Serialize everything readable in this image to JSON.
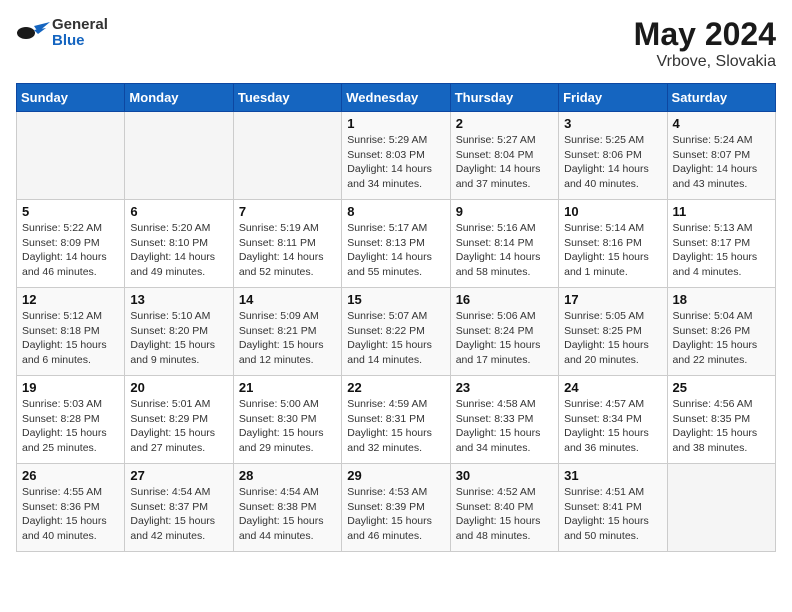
{
  "header": {
    "logo_general": "General",
    "logo_blue": "Blue",
    "month": "May 2024",
    "location": "Vrbove, Slovakia"
  },
  "weekdays": [
    "Sunday",
    "Monday",
    "Tuesday",
    "Wednesday",
    "Thursday",
    "Friday",
    "Saturday"
  ],
  "weeks": [
    [
      {
        "day": "",
        "info": ""
      },
      {
        "day": "",
        "info": ""
      },
      {
        "day": "",
        "info": ""
      },
      {
        "day": "1",
        "info": "Sunrise: 5:29 AM\nSunset: 8:03 PM\nDaylight: 14 hours\nand 34 minutes."
      },
      {
        "day": "2",
        "info": "Sunrise: 5:27 AM\nSunset: 8:04 PM\nDaylight: 14 hours\nand 37 minutes."
      },
      {
        "day": "3",
        "info": "Sunrise: 5:25 AM\nSunset: 8:06 PM\nDaylight: 14 hours\nand 40 minutes."
      },
      {
        "day": "4",
        "info": "Sunrise: 5:24 AM\nSunset: 8:07 PM\nDaylight: 14 hours\nand 43 minutes."
      }
    ],
    [
      {
        "day": "5",
        "info": "Sunrise: 5:22 AM\nSunset: 8:09 PM\nDaylight: 14 hours\nand 46 minutes."
      },
      {
        "day": "6",
        "info": "Sunrise: 5:20 AM\nSunset: 8:10 PM\nDaylight: 14 hours\nand 49 minutes."
      },
      {
        "day": "7",
        "info": "Sunrise: 5:19 AM\nSunset: 8:11 PM\nDaylight: 14 hours\nand 52 minutes."
      },
      {
        "day": "8",
        "info": "Sunrise: 5:17 AM\nSunset: 8:13 PM\nDaylight: 14 hours\nand 55 minutes."
      },
      {
        "day": "9",
        "info": "Sunrise: 5:16 AM\nSunset: 8:14 PM\nDaylight: 14 hours\nand 58 minutes."
      },
      {
        "day": "10",
        "info": "Sunrise: 5:14 AM\nSunset: 8:16 PM\nDaylight: 15 hours\nand 1 minute."
      },
      {
        "day": "11",
        "info": "Sunrise: 5:13 AM\nSunset: 8:17 PM\nDaylight: 15 hours\nand 4 minutes."
      }
    ],
    [
      {
        "day": "12",
        "info": "Sunrise: 5:12 AM\nSunset: 8:18 PM\nDaylight: 15 hours\nand 6 minutes."
      },
      {
        "day": "13",
        "info": "Sunrise: 5:10 AM\nSunset: 8:20 PM\nDaylight: 15 hours\nand 9 minutes."
      },
      {
        "day": "14",
        "info": "Sunrise: 5:09 AM\nSunset: 8:21 PM\nDaylight: 15 hours\nand 12 minutes."
      },
      {
        "day": "15",
        "info": "Sunrise: 5:07 AM\nSunset: 8:22 PM\nDaylight: 15 hours\nand 14 minutes."
      },
      {
        "day": "16",
        "info": "Sunrise: 5:06 AM\nSunset: 8:24 PM\nDaylight: 15 hours\nand 17 minutes."
      },
      {
        "day": "17",
        "info": "Sunrise: 5:05 AM\nSunset: 8:25 PM\nDaylight: 15 hours\nand 20 minutes."
      },
      {
        "day": "18",
        "info": "Sunrise: 5:04 AM\nSunset: 8:26 PM\nDaylight: 15 hours\nand 22 minutes."
      }
    ],
    [
      {
        "day": "19",
        "info": "Sunrise: 5:03 AM\nSunset: 8:28 PM\nDaylight: 15 hours\nand 25 minutes."
      },
      {
        "day": "20",
        "info": "Sunrise: 5:01 AM\nSunset: 8:29 PM\nDaylight: 15 hours\nand 27 minutes."
      },
      {
        "day": "21",
        "info": "Sunrise: 5:00 AM\nSunset: 8:30 PM\nDaylight: 15 hours\nand 29 minutes."
      },
      {
        "day": "22",
        "info": "Sunrise: 4:59 AM\nSunset: 8:31 PM\nDaylight: 15 hours\nand 32 minutes."
      },
      {
        "day": "23",
        "info": "Sunrise: 4:58 AM\nSunset: 8:33 PM\nDaylight: 15 hours\nand 34 minutes."
      },
      {
        "day": "24",
        "info": "Sunrise: 4:57 AM\nSunset: 8:34 PM\nDaylight: 15 hours\nand 36 minutes."
      },
      {
        "day": "25",
        "info": "Sunrise: 4:56 AM\nSunset: 8:35 PM\nDaylight: 15 hours\nand 38 minutes."
      }
    ],
    [
      {
        "day": "26",
        "info": "Sunrise: 4:55 AM\nSunset: 8:36 PM\nDaylight: 15 hours\nand 40 minutes."
      },
      {
        "day": "27",
        "info": "Sunrise: 4:54 AM\nSunset: 8:37 PM\nDaylight: 15 hours\nand 42 minutes."
      },
      {
        "day": "28",
        "info": "Sunrise: 4:54 AM\nSunset: 8:38 PM\nDaylight: 15 hours\nand 44 minutes."
      },
      {
        "day": "29",
        "info": "Sunrise: 4:53 AM\nSunset: 8:39 PM\nDaylight: 15 hours\nand 46 minutes."
      },
      {
        "day": "30",
        "info": "Sunrise: 4:52 AM\nSunset: 8:40 PM\nDaylight: 15 hours\nand 48 minutes."
      },
      {
        "day": "31",
        "info": "Sunrise: 4:51 AM\nSunset: 8:41 PM\nDaylight: 15 hours\nand 50 minutes."
      },
      {
        "day": "",
        "info": ""
      }
    ]
  ]
}
